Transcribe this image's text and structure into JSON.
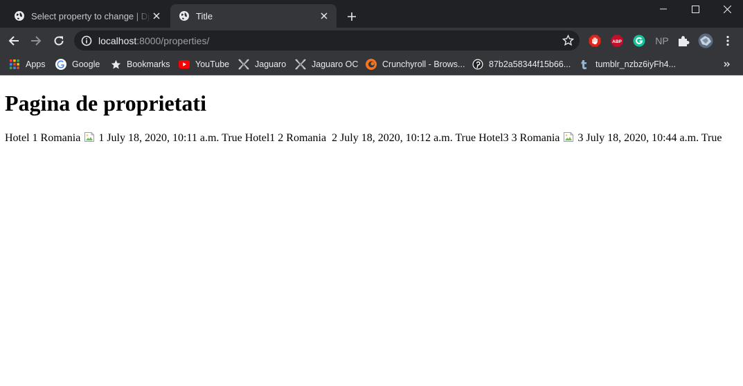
{
  "browser": {
    "tabs": [
      {
        "title": "Select property to change | Django site admin",
        "active": false
      },
      {
        "title": "Title",
        "active": true
      }
    ],
    "address_bar": {
      "host": "localhost",
      "rest": ":8000/properties/"
    },
    "extensions": [
      "adblock-hand-icon",
      "abp-icon",
      "grammarly-icon",
      "np-icon",
      "puzzle-icon",
      "profile-avatar-icon"
    ],
    "bookmarks": [
      {
        "label": "Apps",
        "icon": "apps-grid-icon"
      },
      {
        "label": "Google",
        "icon": "google-icon"
      },
      {
        "label": "Bookmarks",
        "icon": "star-icon"
      },
      {
        "label": "YouTube",
        "icon": "youtube-icon"
      },
      {
        "label": "Jaguaro",
        "icon": "jaguaro-icon"
      },
      {
        "label": "Jaguaro OC",
        "icon": "jaguaro-icon"
      },
      {
        "label": "Crunchyroll - Brows...",
        "icon": "crunchyroll-icon"
      },
      {
        "label": "87b2a58344f15b66...",
        "icon": "pinterest-icon"
      },
      {
        "label": "tumblr_nzbz6iyFh4...",
        "icon": "tumblr-icon"
      }
    ],
    "colors": {
      "tabstrip": "#202124",
      "toolbar": "#35363a",
      "text": "#e8eaed"
    }
  },
  "page": {
    "heading": "Pagina de proprietati",
    "properties": [
      {
        "name": "Hotel 1",
        "country": "Romania",
        "image": "broken",
        "id": "1",
        "date": "July 18, 2020, 10:11 a.m.",
        "active": "True"
      },
      {
        "name": "Hotel1 2",
        "country": "Romania",
        "image": "none",
        "id": "2",
        "date": "July 18, 2020, 10:12 a.m.",
        "active": "True"
      },
      {
        "name": "Hotel3 3",
        "country": "Romania",
        "image": "broken",
        "id": "3",
        "date": "July 18, 2020, 10:44 a.m.",
        "active": "True"
      }
    ]
  }
}
